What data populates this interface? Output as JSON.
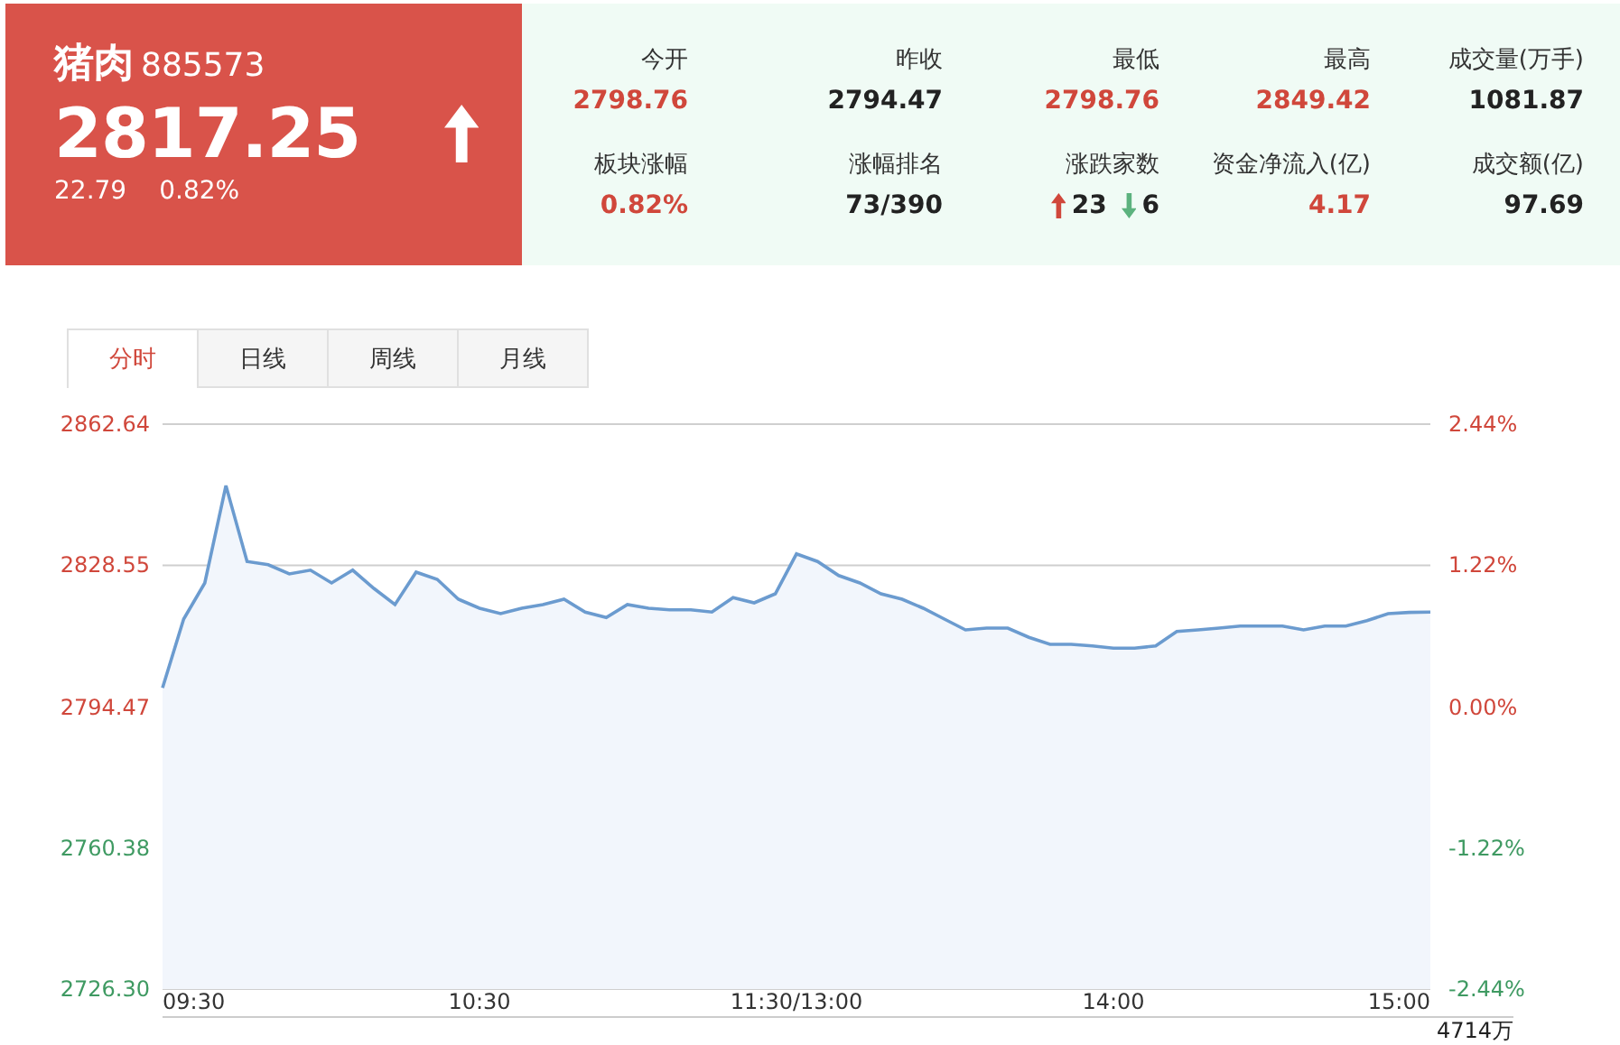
{
  "quote": {
    "name": "猪肉",
    "code": "885573",
    "price": "2817.25",
    "rising": true,
    "change": "22.79",
    "change_pct": "0.82%"
  },
  "stats": [
    {
      "label": "今开",
      "value": "2798.76",
      "color": "#d0473b"
    },
    {
      "label": "昨收",
      "value": "2794.47",
      "color": "#222222"
    },
    {
      "label": "最低",
      "value": "2798.76",
      "color": "#d0473b"
    },
    {
      "label": "最高",
      "value": "2849.42",
      "color": "#d0473b"
    },
    {
      "label": "成交量(万手)",
      "value": "1081.87",
      "color": "#222222"
    },
    {
      "label": "板块涨幅",
      "value": "0.82%",
      "color": "#d0473b"
    },
    {
      "label": "涨幅排名",
      "value": "73/390",
      "color": "#222222"
    },
    {
      "label": "涨跌家数",
      "kind": "counts",
      "up": "23",
      "down": "6"
    },
    {
      "label": "资金净流入(亿)",
      "value": "4.17",
      "color": "#d0473b"
    },
    {
      "label": "成交额(亿)",
      "value": "97.69",
      "color": "#222222"
    }
  ],
  "tabs": [
    {
      "label": "分时",
      "selected": true
    },
    {
      "label": "日线",
      "selected": false
    },
    {
      "label": "周线",
      "selected": false
    },
    {
      "label": "月线",
      "selected": false
    }
  ],
  "chart": {
    "chart_data": {
      "type": "area",
      "grid": true,
      "ylim": [
        2726.3,
        2862.64
      ],
      "yticks": [
        {
          "value": 2862.64,
          "label": "2862.64"
        },
        {
          "value": 2828.55,
          "label": "2828.55"
        },
        {
          "value": 2794.47,
          "label": "2794.47"
        },
        {
          "value": 2760.38,
          "label": "2760.38"
        },
        {
          "value": 2726.3,
          "label": "2726.30"
        }
      ],
      "series": [
        {
          "color": "#6b9bcf",
          "values": [
            2799.0,
            2815.6,
            2824.3,
            2847.8,
            2829.5,
            2828.7,
            2826.5,
            2827.4,
            2824.3,
            2827.4,
            2823.0,
            2819.1,
            2826.9,
            2825.2,
            2820.4,
            2818.2,
            2816.9,
            2818.2,
            2819.1,
            2820.4,
            2817.3,
            2816.0,
            2819.1,
            2818.2,
            2817.8,
            2817.8,
            2817.3,
            2820.8,
            2819.5,
            2821.7,
            2831.3,
            2829.5,
            2826.1,
            2824.3,
            2821.7,
            2820.4,
            2818.2,
            2815.6,
            2813.0,
            2813.4,
            2813.4,
            2811.2,
            2809.5,
            2809.5,
            2809.1,
            2808.6,
            2808.6,
            2809.1,
            2812.6,
            2813.0,
            2813.4,
            2813.9,
            2813.9,
            2813.9,
            2813.0,
            2813.9,
            2813.9,
            2815.2,
            2816.9,
            2817.2,
            2817.3
          ]
        }
      ]
    },
    "time_labels": [
      "09:30",
      "10:30",
      "11:30/13:00",
      "14:00",
      "15:00"
    ],
    "pct_labels": [
      {
        "text": "2.44%",
        "color": "#d0473b"
      },
      {
        "text": "1.22%",
        "color": "#d0473b"
      },
      {
        "text": "0.00%",
        "color": "#d0473b"
      },
      {
        "text": "-1.22%",
        "color": "#3f9a62"
      },
      {
        "text": "-2.44%",
        "color": "#3f9a62"
      }
    ],
    "volume_label": "4714万"
  }
}
